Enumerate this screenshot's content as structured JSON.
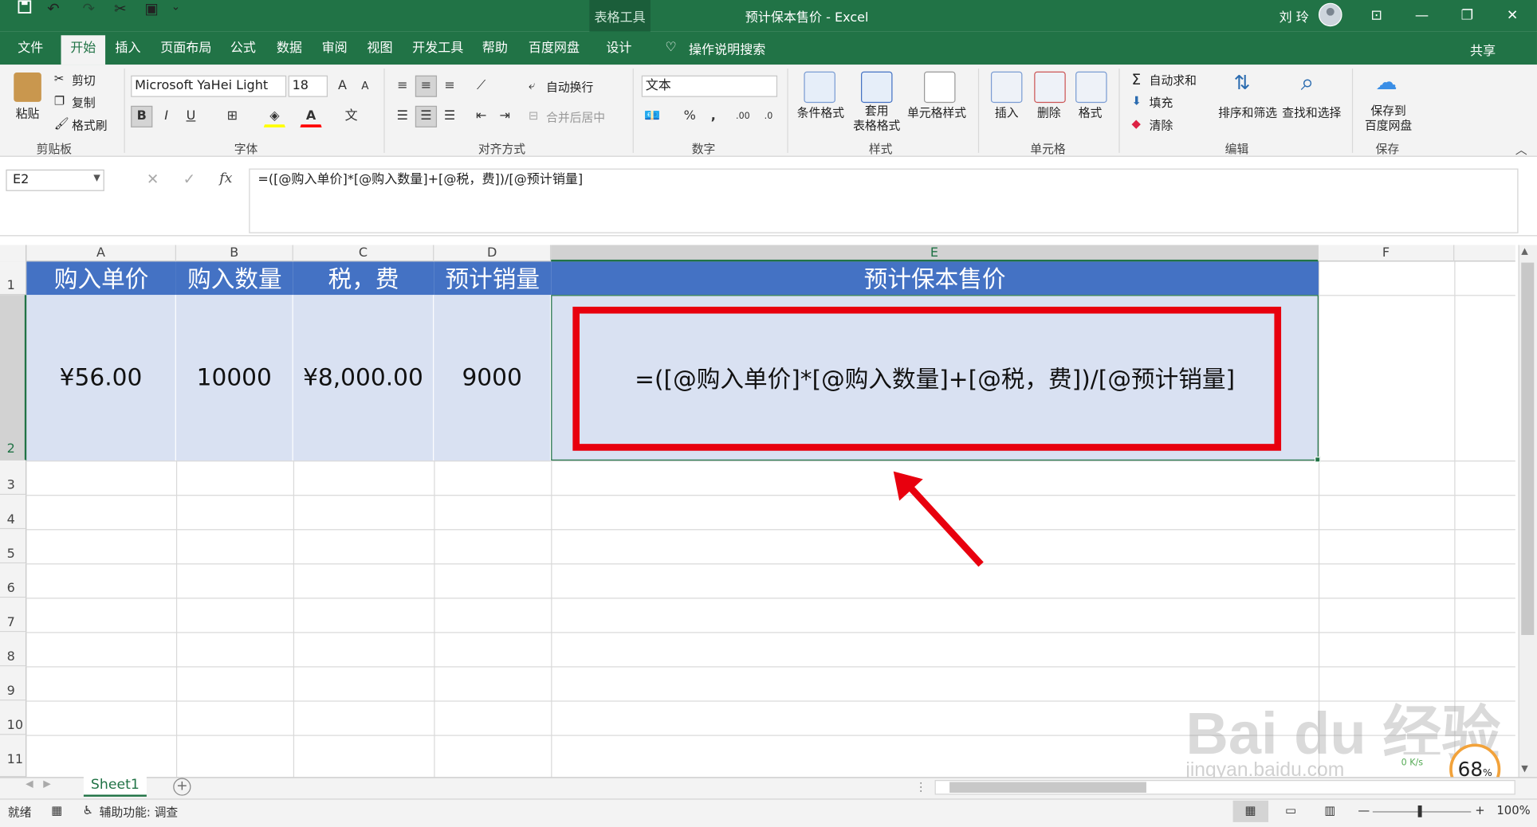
{
  "window": {
    "title": "预计保本售价 - Excel",
    "context_tab_group": "表格工具",
    "user": "刘 玲"
  },
  "tabs": [
    "文件",
    "开始",
    "插入",
    "页面布局",
    "公式",
    "数据",
    "审阅",
    "视图",
    "开发工具",
    "帮助",
    "百度网盘",
    "设计"
  ],
  "tell_me": "操作说明搜索",
  "share": "共享",
  "ribbon": {
    "clipboard": {
      "paste": "粘贴",
      "cut": "剪切",
      "copy": "复制",
      "format_painter": "格式刷",
      "label": "剪贴板"
    },
    "font": {
      "name": "Microsoft YaHei Light",
      "size": "18",
      "bold": "B",
      "italic": "I",
      "underline": "U",
      "label": "字体"
    },
    "alignment": {
      "wrap": "自动换行",
      "merge": "合并后居中",
      "label": "对齐方式"
    },
    "number": {
      "format": "文本",
      "percent": "%",
      "comma": ",",
      "label": "数字"
    },
    "styles": {
      "conditional": "条件格式",
      "table": "套用\n表格格式",
      "cell_styles": "单元格样式",
      "label": "样式"
    },
    "cells": {
      "insert": "插入",
      "delete": "删除",
      "format": "格式",
      "label": "单元格"
    },
    "editing": {
      "autosum": "自动求和",
      "fill": "填充",
      "clear": "清除",
      "sort": "排序和筛选",
      "find": "查找和选择",
      "label": "编辑"
    },
    "save": {
      "save_to": "保存到\n百度网盘",
      "label": "保存"
    }
  },
  "formula_bar": {
    "name_box": "E2",
    "fx": "fx",
    "formula": "=([@购入单价]*[@购入数量]+[@税，费])/[@预计销量]"
  },
  "columns": [
    "A",
    "B",
    "C",
    "D",
    "E",
    "F"
  ],
  "rows": [
    "1",
    "2",
    "3",
    "4",
    "5",
    "6",
    "7",
    "8",
    "9",
    "10",
    "11"
  ],
  "table": {
    "headers": [
      "购入单价",
      "购入数量",
      "税，费",
      "预计销量",
      "预计保本售价"
    ],
    "row": [
      "¥56.00",
      "10000",
      "¥8,000.00",
      "9000",
      "=([@购入单价]*[@购入数量]+[@税，费])/[@预计销量]"
    ]
  },
  "sheet": {
    "name": "Sheet1"
  },
  "status": {
    "ready": "就绪",
    "accessibility": "辅助功能: 调查",
    "zoom": "100%"
  },
  "overlay": {
    "perf": "68",
    "perf_unit": "%",
    "net": "0 K/s",
    "watermark": "Bai du 经验",
    "watermark_url": "jingyan.baidu.com"
  },
  "colors": {
    "excel_green": "#217346",
    "header_blue": "#4472c4",
    "body_blue": "#d9e1f2",
    "callout_red": "#e8000e"
  }
}
